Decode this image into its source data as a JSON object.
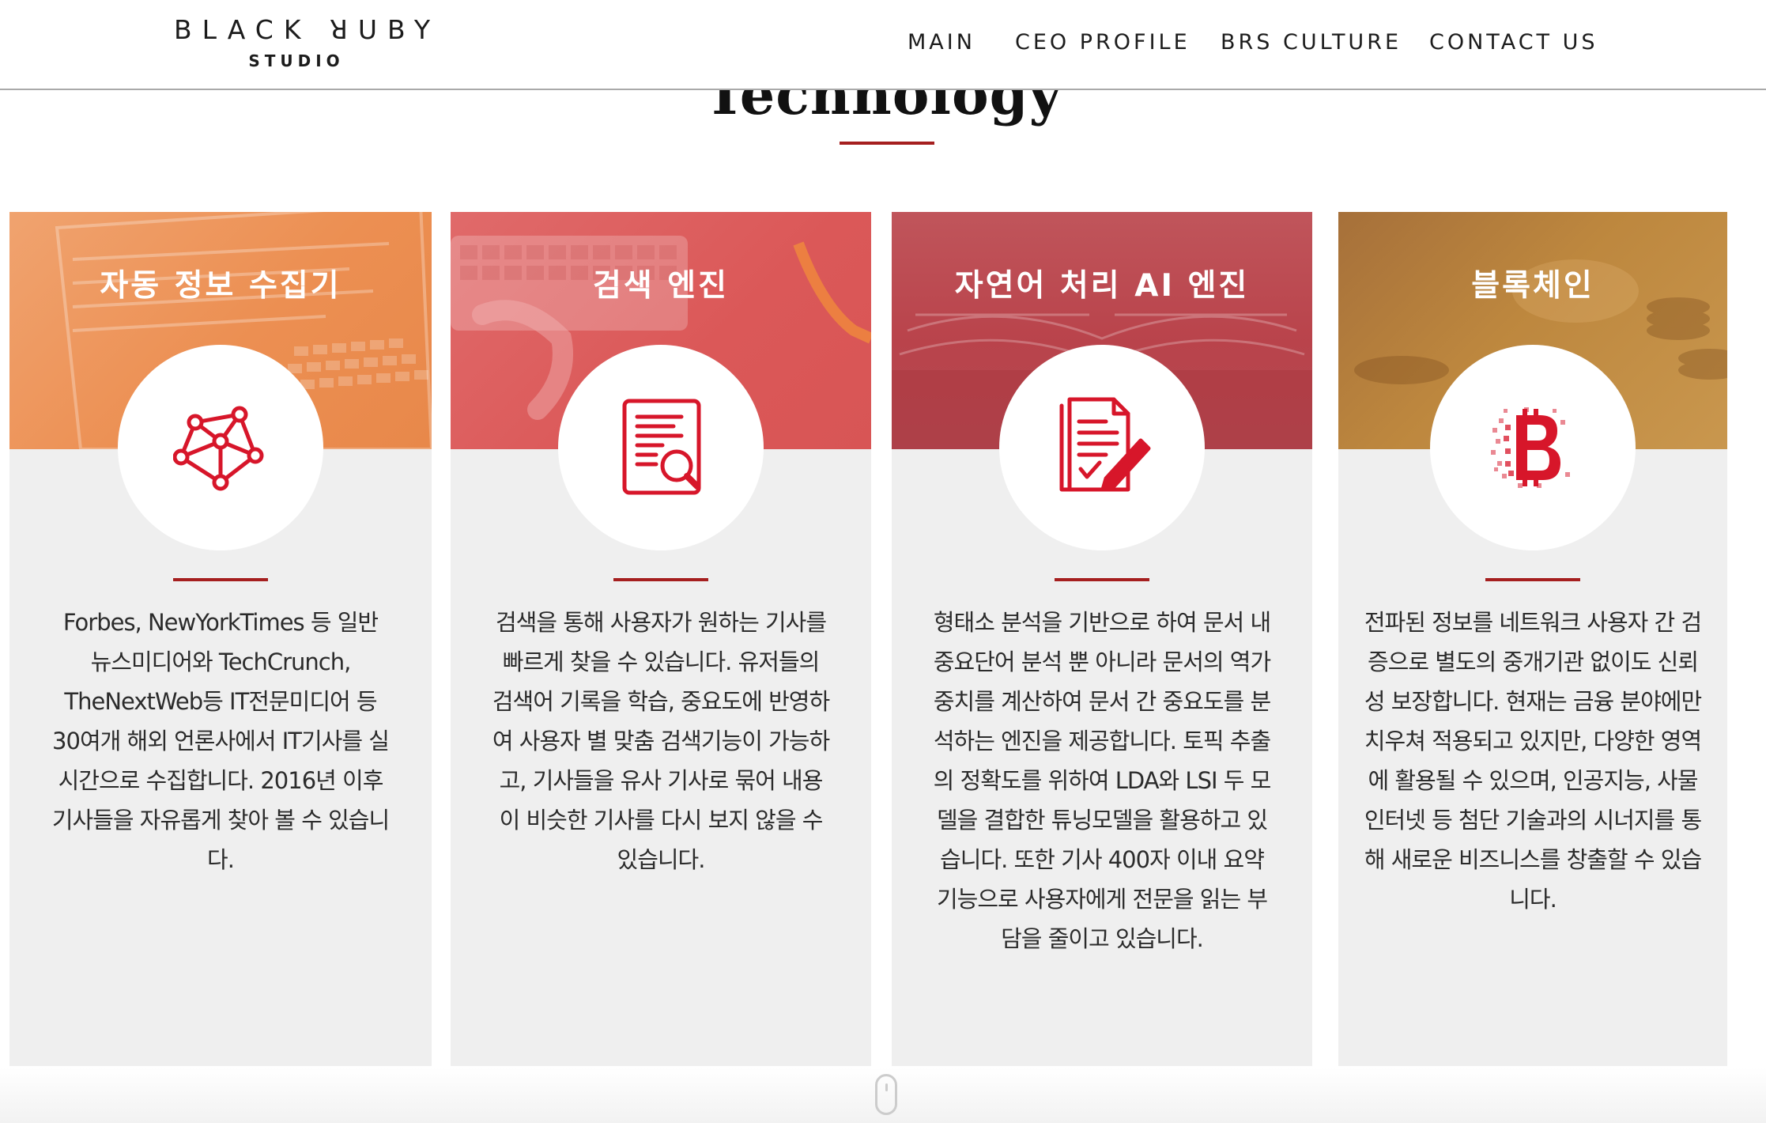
{
  "header": {
    "logo_main": "BLACK ꓤUBY",
    "logo_sub": "STUDIO",
    "nav": [
      "MAIN",
      "CEO PROFILE",
      "BRS CULTURE",
      "CONTACT US"
    ]
  },
  "section": {
    "title": "Technology"
  },
  "colors": {
    "accent": "#a51f1f",
    "icon_red": "#d7162a",
    "card_bg": "#efefef"
  },
  "cards": [
    {
      "title": "자동 정보 수집기",
      "icon": "network-graph-icon",
      "banner_color": "#ed935a",
      "text": "Forbes, NewYorkTimes 등 일반 뉴스미디어와 TechCrunch, TheNextWeb등 IT전문미디어 등 30여개 해외 언론사에서 IT기사를 실시간으로 수집합니다. 2016년 이후 기사들을 자유롭게 찾아 볼 수 있습니다."
    },
    {
      "title": "검색 엔진",
      "icon": "document-search-icon",
      "banner_color": "#de5959",
      "text": "검색을 통해 사용자가 원하는 기사를 빠르게 찾을 수 있습니다. 유저들의 검색어 기록을 학습, 중요도에 반영하여 사용자 별 맞춤 검색기능이 가능하고, 기사들을 유사 기사로 묶어 내용이 비슷한 기사를 다시 보지 않을 수 있습니다."
    },
    {
      "title": "자연어 처리 AI 엔진",
      "icon": "document-edit-icon",
      "banner_color": "#b9434b",
      "text": "형태소 분석을 기반으로 하여 문서 내 중요단어 분석 뿐 아니라 문서의 역가중치를 계산하여 문서 간 중요도를 분석하는 엔진을 제공합니다. 토픽 추출의 정확도를 위하여 LDA와 LSI 두 모델을 결합한 튜닝모델을 활용하고 있습니다. 또한 기사 400자 이내 요약기능으로 사용자에게 전문을 읽는 부담을 줄이고 있습니다."
    },
    {
      "title": "블록체인",
      "icon": "bitcoin-icon",
      "banner_color": "#b9813a",
      "text": "전파된 정보를 네트워크 사용자 간 검증으로 별도의 중개기관 없이도 신뢰성 보장합니다. 현재는 금융 분야에만 치우쳐 적용되고 있지만, 다양한 영역에 활용될 수 있으며, 인공지능, 사물인터넷 등 첨단 기술과의 시너지를 통해 새로운 비즈니스를 창출할 수 있습니다."
    }
  ]
}
